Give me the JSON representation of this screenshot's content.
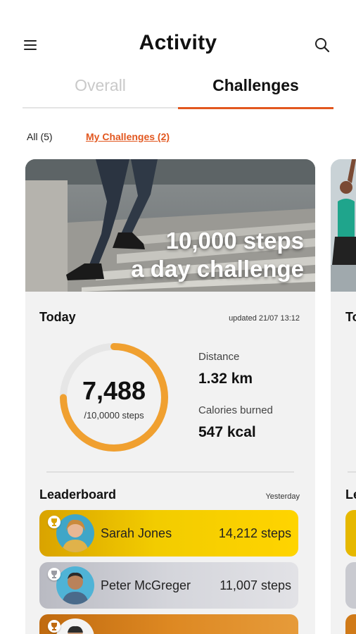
{
  "header": {
    "title": "Activity",
    "menu_icon": "hamburger-menu-icon",
    "search_icon": "search-icon"
  },
  "tabs": [
    {
      "label": "Overall",
      "active": false
    },
    {
      "label": "Challenges",
      "active": true
    }
  ],
  "filters": {
    "all_label": "All (5)",
    "mine_label": "My Challenges (2)"
  },
  "challenge": {
    "title_line1": "10,000 steps",
    "title_line2": "a day challenge",
    "today_label": "Today",
    "updated": "updated 21/07 13:12",
    "steps": "7,488",
    "goal": "/10,0000 steps",
    "progress": 0.7488,
    "distance_label": "Distance",
    "distance_value": "1.32 km",
    "calories_label": "Calories burned",
    "calories_value": "547 kcal",
    "leaderboard_title": "Leaderboard",
    "leaderboard_period": "Yesterday",
    "leaderboard": [
      {
        "name": "Sarah Jones",
        "steps": "14,212 steps",
        "medal": "gold-trophy-icon"
      },
      {
        "name": "Peter McGreger",
        "steps": "11,007 steps",
        "medal": "silver-trophy-icon"
      },
      {
        "name": "",
        "steps": "",
        "medal": "bronze-trophy-icon"
      }
    ]
  },
  "next_card": {
    "today_label": "To",
    "leaderboard_label": "Le"
  },
  "colors": {
    "accent": "#e2571f",
    "ring": "#f0a030",
    "ring_track": "#e6e6e6",
    "gold": "#f2cc00",
    "silver": "#d4d5db",
    "bronze": "#dd8822"
  }
}
